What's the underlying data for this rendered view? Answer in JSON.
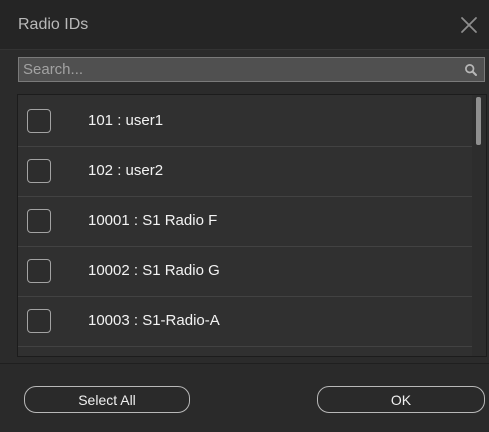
{
  "dialog": {
    "title": "Radio IDs"
  },
  "search": {
    "placeholder": "Search..."
  },
  "items": [
    {
      "label": "101 : user1",
      "checked": false
    },
    {
      "label": "102 : user2",
      "checked": false
    },
    {
      "label": "10001 : S1 Radio F",
      "checked": false
    },
    {
      "label": "10002 : S1 Radio G",
      "checked": false
    },
    {
      "label": "10003 : S1-Radio-A",
      "checked": false
    }
  ],
  "buttons": {
    "select_all": "Select All",
    "ok": "OK"
  },
  "icons": {
    "close": "close-icon",
    "search": "search-icon"
  }
}
